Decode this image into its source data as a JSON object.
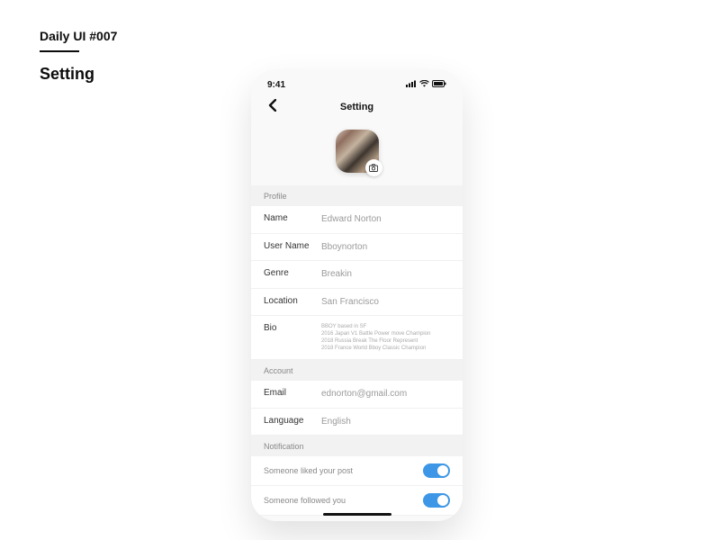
{
  "challenge": "Daily UI #007",
  "page_title": "Setting",
  "status": {
    "time": "9:41"
  },
  "nav": {
    "title": "Setting"
  },
  "sections": {
    "profile": {
      "header": "Profile",
      "name": {
        "label": "Name",
        "value": "Edward Norton"
      },
      "username": {
        "label": "User Name",
        "value": "Bboynorton"
      },
      "genre": {
        "label": "Genre",
        "value": "Breakin"
      },
      "location": {
        "label": "Location",
        "value": "San Francisco"
      },
      "bio": {
        "label": "Bio",
        "value": "BBOY based in SF\n2016 Japan V1 Battle Power move Champion\n2018 Russia Break The Floor Represent\n2018 France World Bboy Classic Champion"
      }
    },
    "account": {
      "header": "Account",
      "email": {
        "label": "Email",
        "value": "ednorton@gmail.com"
      },
      "language": {
        "label": "Language",
        "value": "English"
      }
    },
    "notification": {
      "header": "Notification",
      "liked": {
        "label": "Someone liked your post",
        "on": true
      },
      "followed": {
        "label": "Someone followed you",
        "on": true
      }
    }
  }
}
